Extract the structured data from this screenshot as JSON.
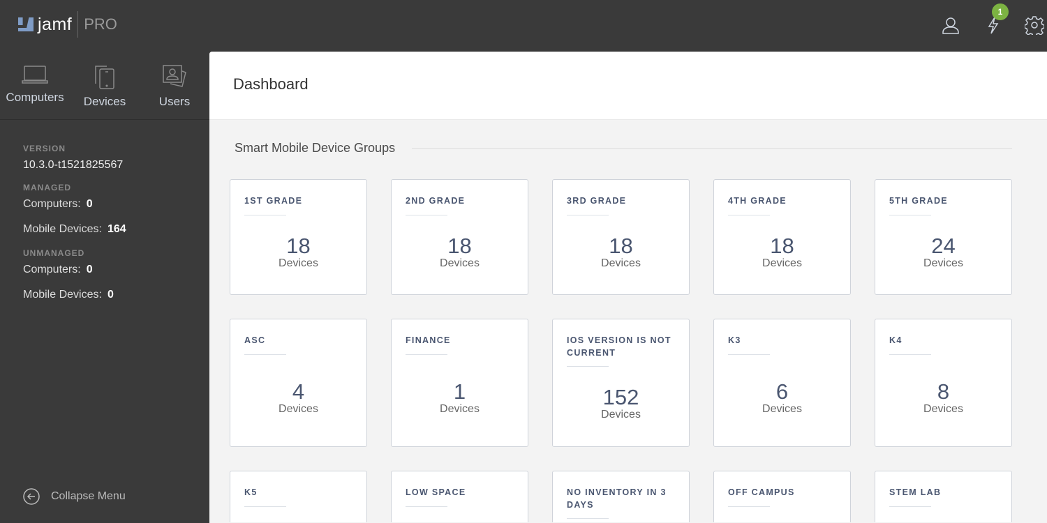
{
  "app": {
    "brand": "jamf",
    "product": "PRO",
    "notification_count": "1"
  },
  "nav": [
    {
      "label": "Computers",
      "icon": "laptop-icon"
    },
    {
      "label": "Devices",
      "icon": "tablet-icon"
    },
    {
      "label": "Users",
      "icon": "user-card-icon"
    }
  ],
  "info": {
    "version_label": "VERSION",
    "version": "10.3.0-t1521825567",
    "managed_label": "MANAGED",
    "managed_computers_label": "Computers:",
    "managed_computers": "0",
    "managed_mobile_label": "Mobile Devices:",
    "managed_mobile": "164",
    "unmanaged_label": "UNMANAGED",
    "unmanaged_computers_label": "Computers:",
    "unmanaged_computers": "0",
    "unmanaged_mobile_label": "Mobile Devices:",
    "unmanaged_mobile": "0"
  },
  "collapse_label": "Collapse Menu",
  "page_title": "Dashboard",
  "section_title": "Smart Mobile Device Groups",
  "cards": [
    {
      "title": "1ST GRADE",
      "count": "18",
      "unit": "Devices"
    },
    {
      "title": "2ND GRADE",
      "count": "18",
      "unit": "Devices"
    },
    {
      "title": "3RD GRADE",
      "count": "18",
      "unit": "Devices"
    },
    {
      "title": "4TH GRADE",
      "count": "18",
      "unit": "Devices"
    },
    {
      "title": "5TH GRADE",
      "count": "24",
      "unit": "Devices"
    },
    {
      "title": "ASC",
      "count": "4",
      "unit": "Devices"
    },
    {
      "title": "FINANCE",
      "count": "1",
      "unit": "Devices"
    },
    {
      "title": "IOS VERSION IS NOT CURRENT",
      "count": "152",
      "unit": "Devices"
    },
    {
      "title": "K3",
      "count": "6",
      "unit": "Devices"
    },
    {
      "title": "K4",
      "count": "8",
      "unit": "Devices"
    },
    {
      "title": "K5"
    },
    {
      "title": "LOW SPACE"
    },
    {
      "title": "NO INVENTORY IN 3 DAYS"
    },
    {
      "title": "OFF CAMPUS"
    },
    {
      "title": "STEM LAB"
    }
  ]
}
